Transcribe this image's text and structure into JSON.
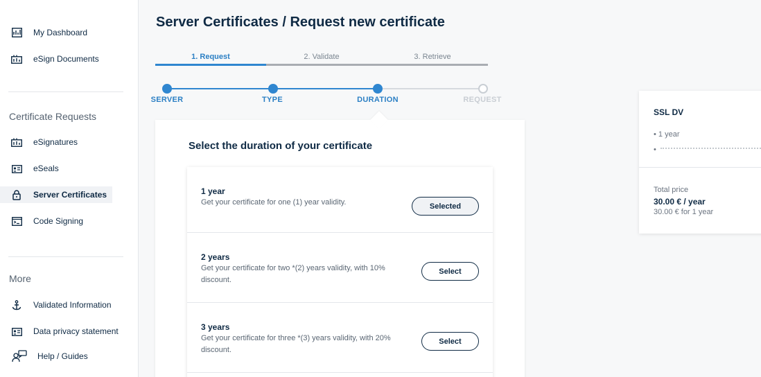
{
  "sidebar": {
    "top_items": [
      {
        "label": "My Dashboard",
        "icon": "dashboard-icon"
      },
      {
        "label": "eSign Documents",
        "icon": "esign-icon"
      }
    ],
    "section1_heading": "Certificate Requests",
    "cert_items": [
      {
        "label": "eSignatures",
        "icon": "esignature-icon"
      },
      {
        "label": "eSeals",
        "icon": "eseal-icon"
      },
      {
        "label": "Server Certificates",
        "icon": "lock-icon",
        "active": true
      },
      {
        "label": "Code Signing",
        "icon": "terminal-icon"
      }
    ],
    "section2_heading": "More",
    "more_items": [
      {
        "label": "Validated Information",
        "icon": "anchor-icon"
      },
      {
        "label": "Data privacy statement",
        "icon": "privacy-icon"
      },
      {
        "label": "Help / Guides",
        "icon": "help-icon"
      }
    ]
  },
  "header": {
    "title": "Server Certificates / Request new certificate"
  },
  "tabs": [
    {
      "label": "1. Request",
      "active": true
    },
    {
      "label": "2. Validate",
      "active": false
    },
    {
      "label": "3. Retrieve",
      "active": false
    }
  ],
  "stepper": [
    {
      "label": "SERVER",
      "done": true
    },
    {
      "label": "TYPE",
      "done": true
    },
    {
      "label": "DURATION",
      "done": true
    },
    {
      "label": "REQUEST",
      "done": false
    }
  ],
  "card": {
    "title": "Select the duration of your certificate",
    "options": [
      {
        "title": "1 year",
        "desc": "Get your certificate for one (1) year validity.",
        "button": "Selected",
        "selected": true
      },
      {
        "title": "2 years",
        "desc": "Get your certificate for two *(2) years validity, with 10% discount.",
        "button": "Select",
        "selected": false
      },
      {
        "title": "3 years",
        "desc": "Get your certificate for three *(3) years validity, with 20% discount.",
        "button": "Select",
        "selected": false
      }
    ]
  },
  "summary": {
    "title": "SSL DV",
    "bullet1": "• 1 year",
    "bullet2": "•",
    "total_label": "Total price",
    "price": "30.00 € / year",
    "price_sub": "30.00 € for 1 year"
  },
  "colors": {
    "accent": "#2f86d0",
    "text": "#0f2a44",
    "muted": "#5a6673"
  }
}
